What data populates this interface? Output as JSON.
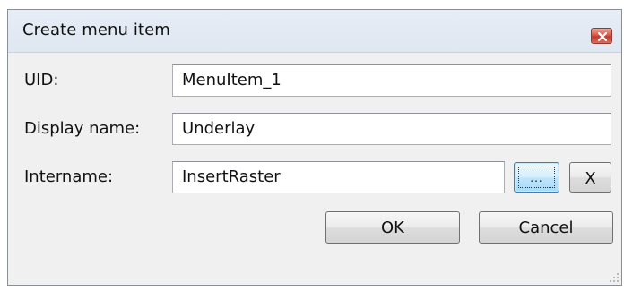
{
  "window": {
    "title": "Create menu item",
    "close_icon": "close-icon",
    "close_color": "#c6392a"
  },
  "form": {
    "uid": {
      "label": "UID:",
      "value": "MenuItem_1"
    },
    "display_name": {
      "label": "Display name:",
      "value": "Underlay"
    },
    "intername": {
      "label": "Intername:",
      "value": "InsertRaster",
      "browse_label": "...",
      "clear_label": "X"
    }
  },
  "buttons": {
    "ok_label": "OK",
    "cancel_label": "Cancel"
  },
  "icons": {
    "resize_grip": "resize-grip-icon"
  }
}
